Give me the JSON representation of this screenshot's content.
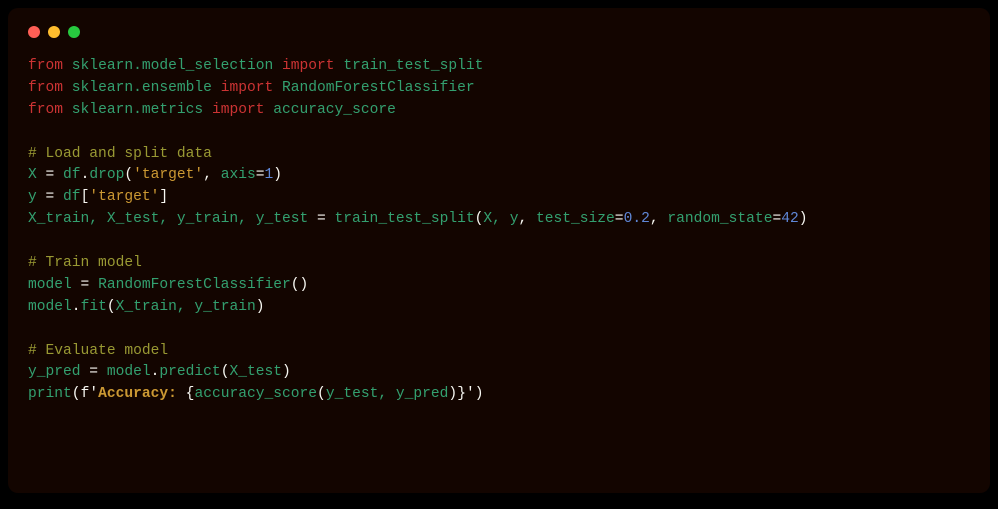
{
  "code": {
    "l1": {
      "from": "from",
      "mod": "sklearn.model_selection",
      "imp": "import",
      "name": "train_test_split"
    },
    "l2": {
      "from": "from",
      "mod": "sklearn.ensemble",
      "imp": "import",
      "name": "RandomForestClassifier"
    },
    "l3": {
      "from": "from",
      "mod": "sklearn.metrics",
      "imp": "import",
      "name": "accuracy_score"
    },
    "l5": {
      "comment": "# Load and split data"
    },
    "l6": {
      "var": "X",
      "eq": " = ",
      "df": "df",
      "dot": ".",
      "drop": "drop",
      "lp": "(",
      "str": "'target'",
      "comma": ", ",
      "axis": "axis",
      "eq2": "=",
      "num": "1",
      "rp": ")"
    },
    "l7": {
      "var": "y",
      "eq": " = ",
      "df": "df",
      "lb": "[",
      "str": "'target'",
      "rb": "]"
    },
    "l8": {
      "vars": "X_train, X_test, y_train, y_test",
      "eq": " = ",
      "fn": "train_test_split",
      "lp": "(",
      "args": "X, y",
      "comma": ", ",
      "p1": "test_size",
      "eq1": "=",
      "n1": "0.2",
      "comma2": ", ",
      "p2": "random_state",
      "eq2": "=",
      "n2": "42",
      "rp": ")"
    },
    "l10": {
      "comment": "# Train model"
    },
    "l11": {
      "var": "model",
      "eq": " = ",
      "cls": "RandomForestClassifier",
      "lp": "(",
      "rp": ")"
    },
    "l12": {
      "obj": "model",
      "dot": ".",
      "fn": "fit",
      "lp": "(",
      "args": "X_train, y_train",
      "rp": ")"
    },
    "l14": {
      "comment": "# Evaluate model"
    },
    "l15": {
      "var": "y_pred",
      "eq": " = ",
      "obj": "model",
      "dot": ".",
      "fn": "predict",
      "lp": "(",
      "args": "X_test",
      "rp": ")"
    },
    "l16": {
      "print": "print",
      "lp": "(",
      "f": "f",
      "q1": "'",
      "txt": "Accuracy: ",
      "lb": "{",
      "fn": "accuracy_score",
      "lp2": "(",
      "args": "y_test, y_pred",
      "rp2": ")",
      "rb": "}",
      "q2": "'",
      "rp": ")"
    }
  }
}
